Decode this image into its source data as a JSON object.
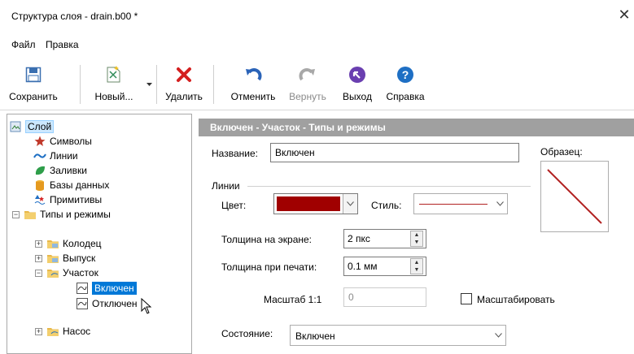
{
  "window": {
    "title": "Структура слоя - drain.b00 *",
    "close_glyph": "✕"
  },
  "menu": {
    "items": [
      "Файл",
      "Правка"
    ]
  },
  "toolbar": {
    "save": "Сохранить",
    "new": "Новый...",
    "delete": "Удалить",
    "undo": "Отменить",
    "redo": "Вернуть",
    "exit": "Выход",
    "help": "Справка"
  },
  "tree": {
    "root": "Слой",
    "symbols": "Символы",
    "lines": "Линии",
    "fills": "Заливки",
    "databases": "Базы данных",
    "primitives": "Примитивы",
    "types": "Типы и режимы",
    "well": "Колодец",
    "outlet": "Выпуск",
    "section": "Участок",
    "enabled": "Включен",
    "disabled": "Отключен",
    "pump": "Насос"
  },
  "panel": {
    "header": "Включен - Участок - Типы и режимы",
    "name_label": "Название:",
    "name_value": "Включен",
    "sample_label": "Образец:",
    "lines_group": "Линии",
    "color_label": "Цвет:",
    "color_value": "#a00000",
    "style_label": "Стиль:",
    "screen_thickness_label": "Толщина на экране:",
    "screen_thickness_value": "2 пкс",
    "print_thickness_label": "Толщина при печати:",
    "print_thickness_value": "0.1 мм",
    "scale_label": "Масштаб 1:1",
    "scale_value": "0",
    "scale_checkbox_label": "Масштабировать",
    "state_label": "Состояние:",
    "state_value": "Включен"
  },
  "colors": {
    "accent": "#0078d7",
    "header_bg": "#a0a0a0",
    "line_sample": "#b22222"
  }
}
